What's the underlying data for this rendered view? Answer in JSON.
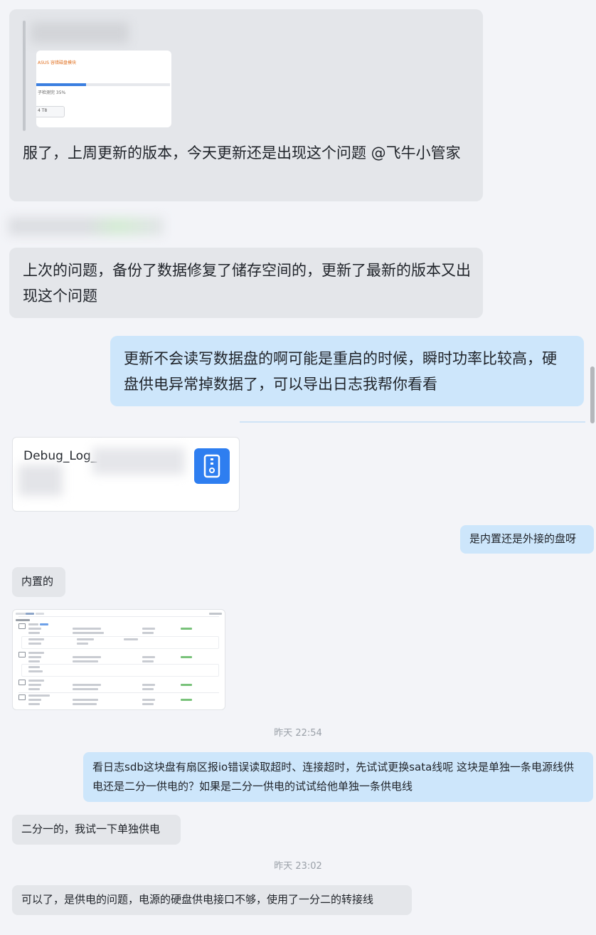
{
  "messages": {
    "m1_quote": {
      "thumb_orange_text": "ASUS 容错磁盘模块",
      "thumb_progress_text": "子检测完 35%",
      "thumb_button_text": "4 T8"
    },
    "m1_text": "服了，上周更新的版本，今天更新还是出现这个问题 @飞牛小管家",
    "m2_text": "上次的问题，备份了数据修复了储存空间的，更新了最新的版本又出现这个问题",
    "m3_text": "更新不会读写数据盘的啊可能是重启的时候，瞬时功率比较高，硬盘供电异常掉数据了，可以导出日志我帮你看看",
    "file_name": "Debug_Log_",
    "m4_text": "是内置还是外接的盘呀",
    "m5_text": "内置的",
    "time1": "昨天 22:54",
    "m6_text": "看日志sdb这块盘有扇区报io错误读取超时、连接超时，先试试更换sata线呢 这块是单独一条电源线供电还是二分一供电的？如果是二分一供电的试试给他单独一条供电线",
    "m7_text": "二分一的，我试一下单独供电",
    "time2": "昨天 23:02",
    "m8_text": "可以了，是供电的问题，电源的硬盘供电接口不够，使用了一分二的转接线"
  },
  "icons": {
    "file": "file-zip-icon"
  },
  "colors": {
    "page_bg": "#f3f4f8",
    "bubble_gray": "#e4e6ea",
    "bubble_blue": "#cde6fb",
    "file_icon": "#2e7ef0"
  }
}
